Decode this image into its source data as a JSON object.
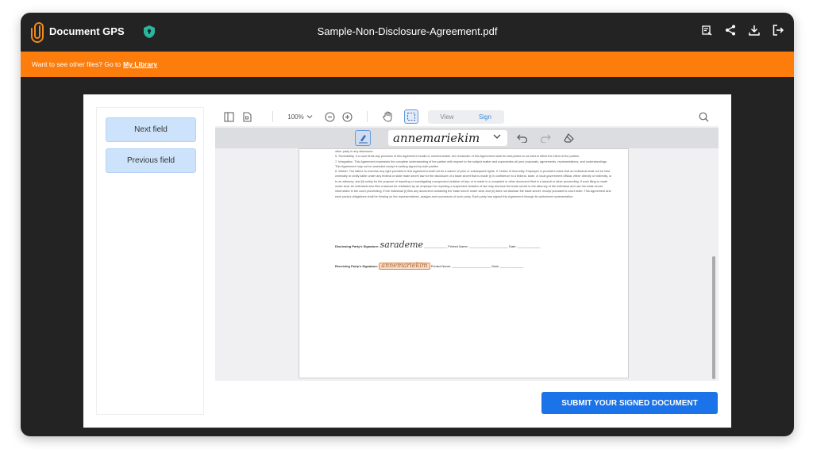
{
  "topbar": {
    "app_title": "Document GPS",
    "file_name": "Sample-Non-Disclosure-Agreement.pdf",
    "icons": [
      "fields-icon",
      "share-icon",
      "download-icon",
      "logout-icon"
    ]
  },
  "banner": {
    "text": "Want to see other files? Go to",
    "link": "My Library",
    "color": "#fd7d0c"
  },
  "left_panel": {
    "next_field": "Next field",
    "previous_field": "Previous field"
  },
  "toolbar": {
    "zoom": "100%",
    "mode_view": "View",
    "mode_sign": "Sign",
    "active_mode": "Sign",
    "signature_name": "annemariekim"
  },
  "document": {
    "paragraphs": [
      "other party in any disclosure.",
      "5. Severability. If a court finds any provision of this Agreement invalid or unenforceable, the remainder of this Agreement shall be interpreted so as best to effect the intent of the parties.",
      "7. Integration. This Agreement expresses the complete understanding of the parties with respect to the subject matter and supersedes all prior proposals, agreements, representations, and understandings. This Agreement may not be amended except in writing signed by both parties.",
      "8. Waiver. The failure to exercise any right provided in this Agreement shall not be a waiver of prior or subsequent rights. 9. Notice of Immunity. Employee is provided notice that an individual shall not be held criminally or civilly liable under any federal or state trade secret law for the disclosure of a trade secret that is made (i) in confidence to a federal, state, or local government official, either directly or indirectly, or to an attorney; and (ii) solely for the purpose of reporting or investigating a suspected violation of law; or is made in a complaint or other document filed in a lawsuit or other proceeding, if such filing is made under seal. An individual who files a lawsuit for retaliation by an employer for reporting a suspected violation of law may disclose the trade secret to the attorney of the individual and use the trade secret information in the court proceeding, if the individual (i) files any document containing the trade secret under seal; and (ii) does not disclose the trade secret, except pursuant to court order. This Agreement and each party's obligations shall be binding on the representatives, assigns and successors of such party. Each party has signed this Agreement through its authorized representative."
    ],
    "disclosing_label": "Disclosing Party's Signature:",
    "disclosing_signature": "sarademe",
    "receiving_label": "Receiving Party's Signature:",
    "receiving_signature": "annemariekim",
    "printed_name_label": "Printed Name:",
    "date_label": "Date:",
    "blank_line": "______________________",
    "blank_short": "_____________"
  },
  "submit_label": "SUBMIT YOUR SIGNED DOCUMENT",
  "colors": {
    "accent": "#1a73e8",
    "banner": "#fd7d0c",
    "window": "#232323",
    "shield": "#2bb5a0"
  }
}
